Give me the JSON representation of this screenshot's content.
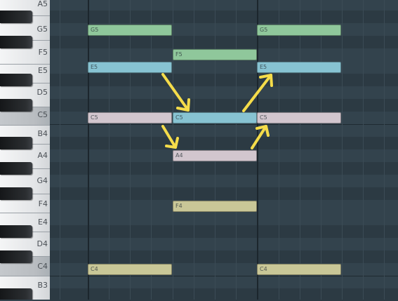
{
  "piano": {
    "white_keys": [
      {
        "id": "a5",
        "label": "A5"
      },
      {
        "id": "g5",
        "label": "G5"
      },
      {
        "id": "f5",
        "label": "F5"
      },
      {
        "id": "e5",
        "label": "E5"
      },
      {
        "id": "d5",
        "label": "D5"
      },
      {
        "id": "c5",
        "label": "C5"
      },
      {
        "id": "b4",
        "label": "B4"
      },
      {
        "id": "a4",
        "label": "A4"
      },
      {
        "id": "g4",
        "label": "G4"
      },
      {
        "id": "f4",
        "label": "F4"
      },
      {
        "id": "e4",
        "label": "E4"
      },
      {
        "id": "d4",
        "label": "D4"
      },
      {
        "id": "c4",
        "label": "C4"
      },
      {
        "id": "b3",
        "label": "B3"
      }
    ]
  },
  "notes": [
    {
      "id": "g5-1",
      "label": "G5",
      "color": "#8fc79b"
    },
    {
      "id": "g5-2",
      "label": "G5",
      "color": "#8fc79b"
    },
    {
      "id": "f5-1",
      "label": "F5",
      "color": "#8fc79b"
    },
    {
      "id": "e5-1",
      "label": "E5",
      "color": "#87c3d2"
    },
    {
      "id": "e5-2",
      "label": "E5",
      "color": "#87c3d2"
    },
    {
      "id": "c5-1",
      "label": "C5",
      "color": "#d2c6ce"
    },
    {
      "id": "c5-2",
      "label": "C5",
      "color": "#87c3d2"
    },
    {
      "id": "c5-3",
      "label": "C5",
      "color": "#d2c6ce"
    },
    {
      "id": "a4-1",
      "label": "A4",
      "color": "#d2c6ce"
    },
    {
      "id": "f4-1",
      "label": "F4",
      "color": "#c9c797"
    },
    {
      "id": "c4-1",
      "label": "C4",
      "color": "#c9c797"
    },
    {
      "id": "c4-2",
      "label": "C4",
      "color": "#c9c797"
    }
  ],
  "annotation": {
    "arrow_color": "#f5dc4a"
  }
}
